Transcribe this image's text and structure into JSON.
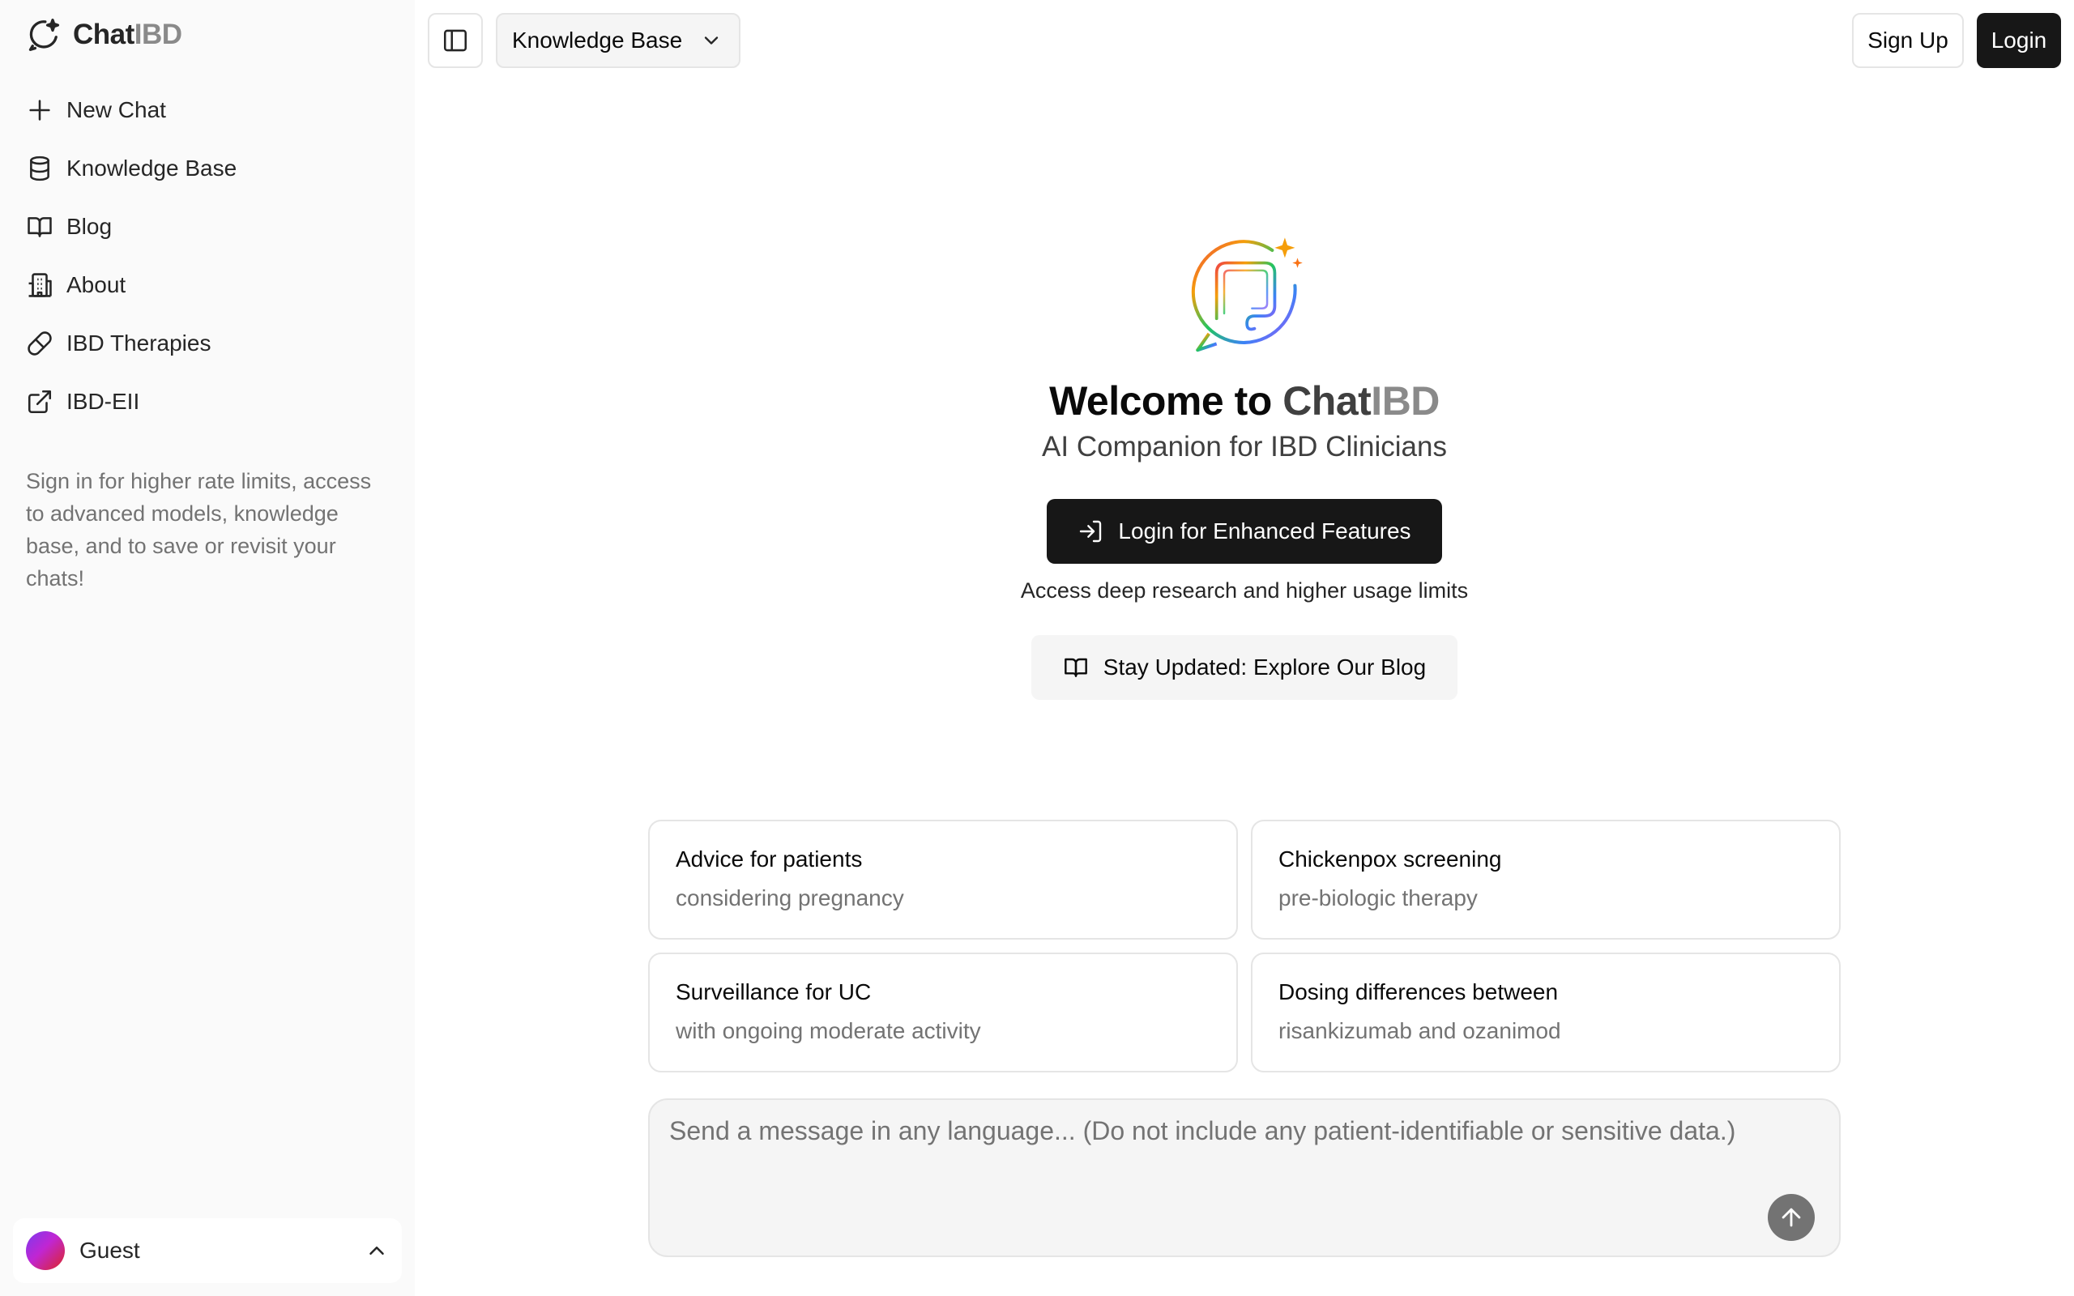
{
  "brand": {
    "name_part1": "Chat",
    "name_part2": "IBD"
  },
  "sidebar": {
    "items": [
      {
        "label": "New Chat",
        "icon": "plus-icon"
      },
      {
        "label": "Knowledge Base",
        "icon": "database-icon"
      },
      {
        "label": "Blog",
        "icon": "book-open-icon"
      },
      {
        "label": "About",
        "icon": "building-icon"
      },
      {
        "label": "IBD Therapies",
        "icon": "pill-icon"
      },
      {
        "label": "IBD-EII",
        "icon": "external-link-icon"
      }
    ],
    "signin_note": "Sign in for higher rate limits, access to advanced models, knowledge base, and to save or revisit your chats!",
    "user": {
      "name": "Guest"
    }
  },
  "header": {
    "kb_select_label": "Knowledge Base",
    "signup_label": "Sign Up",
    "login_label": "Login"
  },
  "hero": {
    "welcome_prefix": "Welcome to ",
    "welcome_brand1": "Chat",
    "welcome_brand2": "IBD",
    "subtitle": "AI Companion for IBD Clinicians",
    "enhanced_label": "Login for Enhanced Features",
    "access_note": "Access deep research and higher usage limits",
    "blog_label": "Stay Updated: Explore Our Blog"
  },
  "suggestions": [
    {
      "title": "Advice for patients",
      "subtitle": "considering pregnancy"
    },
    {
      "title": "Chickenpox screening",
      "subtitle": "pre-biologic therapy"
    },
    {
      "title": "Surveillance for UC",
      "subtitle": "with ongoing moderate activity"
    },
    {
      "title": "Dosing differences between",
      "subtitle": "risankizumab and ozanimod"
    }
  ],
  "composer": {
    "placeholder": "Send a message in any language... (Do not include any patient-identifiable or sensitive data.)",
    "value": ""
  },
  "colors": {
    "primary": "#171717",
    "muted_text": "#737373",
    "sidebar_bg": "#fafafa",
    "border": "#e5e5e5"
  }
}
